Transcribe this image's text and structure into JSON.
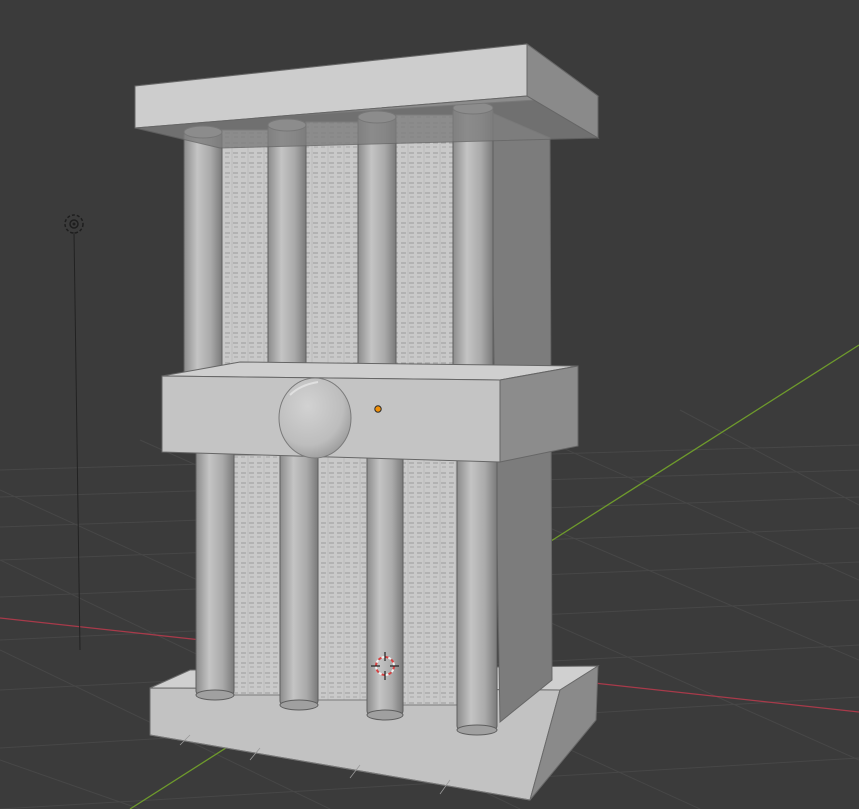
{
  "viewport": {
    "background": "#3b3b3b",
    "grid_color": "#474747",
    "x_axis_color": "#a83a4a",
    "y_axis_color": "#6e9a2c"
  },
  "scene": {
    "object": "pillared-tower-mesh",
    "shading": "solid",
    "mesh_color": "#b8b8b8"
  },
  "icons": {
    "light": "light-icon",
    "origin": "object-origin-icon",
    "cursor": "3d-cursor-icon"
  }
}
